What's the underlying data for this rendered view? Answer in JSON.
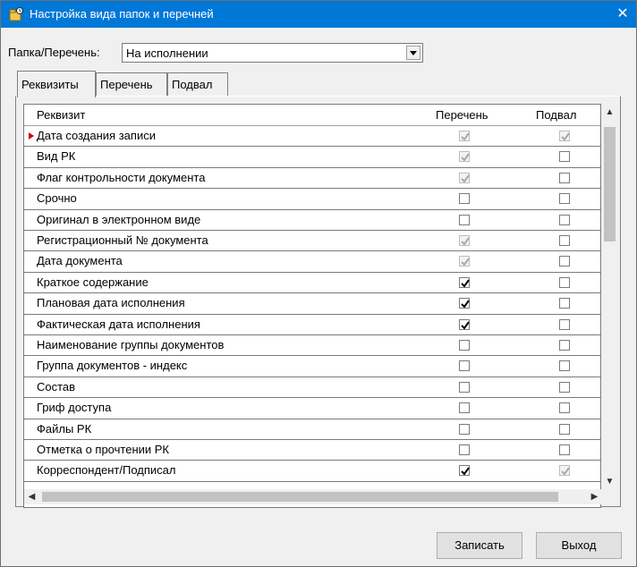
{
  "window": {
    "title": "Настройка вида папок и перечней",
    "close_glyph": "✕"
  },
  "folder": {
    "label": "Папка/Перечень:",
    "value": "На исполнении"
  },
  "tabs": [
    {
      "label": "Реквизиты",
      "active": true
    },
    {
      "label": "Перечень",
      "active": false
    },
    {
      "label": "Подвал",
      "active": false
    }
  ],
  "grid": {
    "columns": {
      "name": "Реквизит",
      "list": "Перечень",
      "footer": "Подвал"
    },
    "rows": [
      {
        "name": "Дата создания записи",
        "list": "checked-disabled",
        "footer": "checked-disabled",
        "current": true
      },
      {
        "name": "Вид РК",
        "list": "checked-disabled",
        "footer": "unchecked"
      },
      {
        "name": "Флаг контрольности документа",
        "list": "checked-disabled",
        "footer": "unchecked"
      },
      {
        "name": "Срочно",
        "list": "unchecked",
        "footer": "unchecked"
      },
      {
        "name": "Оригинал в электронном виде",
        "list": "unchecked",
        "footer": "unchecked"
      },
      {
        "name": "Регистрационный № документа",
        "list": "checked-disabled",
        "footer": "unchecked"
      },
      {
        "name": "Дата документа",
        "list": "checked-disabled",
        "footer": "unchecked"
      },
      {
        "name": "Краткое содержание",
        "list": "checked",
        "footer": "unchecked"
      },
      {
        "name": "Плановая дата исполнения",
        "list": "checked",
        "footer": "unchecked"
      },
      {
        "name": "Фактическая дата исполнения",
        "list": "checked",
        "footer": "unchecked"
      },
      {
        "name": "Наименование группы документов",
        "list": "unchecked",
        "footer": "unchecked"
      },
      {
        "name": "Группа документов - индекс",
        "list": "unchecked",
        "footer": "unchecked"
      },
      {
        "name": "Состав",
        "list": "unchecked",
        "footer": "unchecked"
      },
      {
        "name": "Гриф доступа",
        "list": "unchecked",
        "footer": "unchecked"
      },
      {
        "name": "Файлы РК",
        "list": "unchecked",
        "footer": "unchecked"
      },
      {
        "name": "Отметка о прочтении РК",
        "list": "unchecked",
        "footer": "unchecked"
      },
      {
        "name": "Корреспондент/Подписал",
        "list": "checked",
        "footer": "checked-disabled"
      }
    ]
  },
  "buttons": {
    "save": "Записать",
    "exit": "Выход"
  },
  "colors": {
    "titlebar": "#0078d7",
    "current_marker": "#d00000"
  }
}
